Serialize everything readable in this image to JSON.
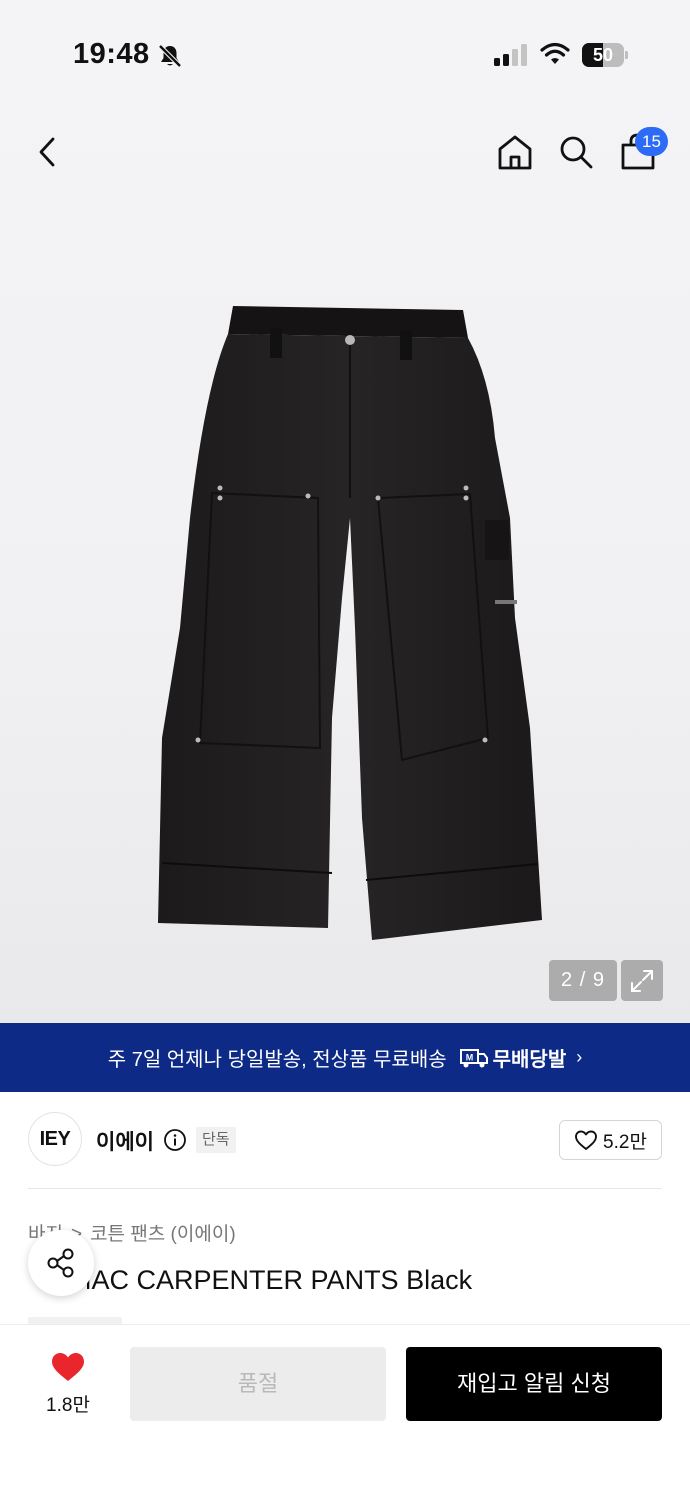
{
  "status_bar": {
    "time": "19:48",
    "battery": "50",
    "battery_level_percent": 50
  },
  "header": {
    "cart_count": "15",
    "icons": [
      "back-icon",
      "home-icon",
      "search-icon",
      "shopping-bag-icon"
    ]
  },
  "gallery": {
    "pager": "2 / 9"
  },
  "promo": {
    "text": "주 7일 언제나 당일발송, 전상품 무료배송",
    "logo_text": "무배당발",
    "logo_mark": "M",
    "chevron": "›"
  },
  "brand": {
    "logo_text": "IEY",
    "name": "이에이",
    "tag": "단독",
    "likes": "5.2만"
  },
  "breadcrumb": {
    "category": "바지",
    "separator": ">",
    "subcategory": "코튼 팬츠 (이에이)"
  },
  "product": {
    "title": "MAC CARPENTER PANTS Black",
    "title_prefix": "I"
  },
  "bottom_bar": {
    "heart_count": "1.8만",
    "soldout_label": "품절",
    "restock_label": "재입고 알림 신청"
  },
  "colors": {
    "promo_bg": "#0c2a86",
    "badge": "#2b6bf5",
    "heart": "#e8262b",
    "primary_btn": "#000000"
  }
}
